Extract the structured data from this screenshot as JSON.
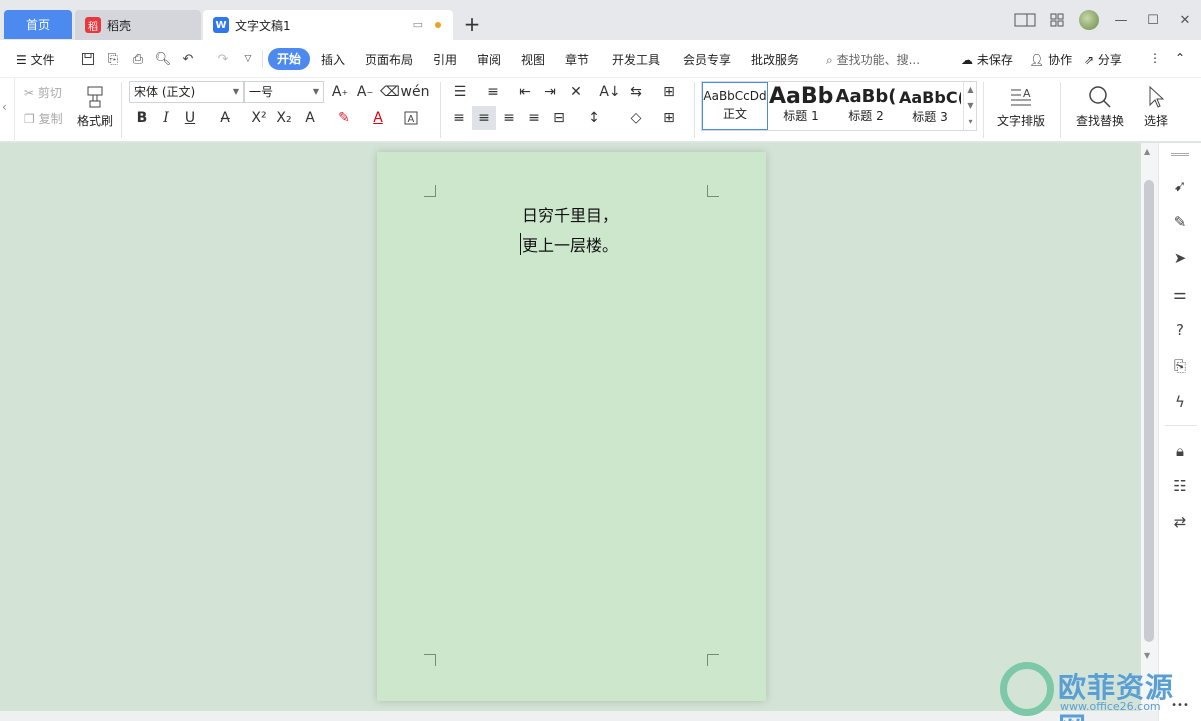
{
  "tabs": {
    "home": "首页",
    "daoke": "稻壳",
    "document": "文字文稿1"
  },
  "menu": {
    "file": "文件",
    "items": [
      "开始",
      "插入",
      "页面布局",
      "引用",
      "审阅",
      "视图",
      "章节",
      "开发工具",
      "会员专享",
      "批改服务"
    ],
    "search_placeholder": "查找功能、搜...",
    "unsaved": "未保存",
    "collaborate": "协作",
    "share": "分享"
  },
  "ribbon": {
    "cut": "剪切",
    "copy": "复制",
    "format_painter": "格式刷",
    "font_name": "宋体 (正文)",
    "font_size": "一号",
    "styles": [
      {
        "preview": "AaBbCcDd",
        "name": "正文"
      },
      {
        "preview": "AaBb",
        "name": "标题 1"
      },
      {
        "preview": "AaBb(",
        "name": "标题 2"
      },
      {
        "preview": "AaBbC(",
        "name": "标题 3"
      }
    ],
    "text_layout": "文字排版",
    "find_replace": "查找替换",
    "select": "选择"
  },
  "document": {
    "lines": [
      "日穷千里目，",
      "更上一层楼。"
    ]
  },
  "watermark": {
    "brand": "欧菲资源网",
    "url": "www.office26.com"
  },
  "colors": {
    "accent": "#4d8af0",
    "page_bg": "#cde7cd",
    "doc_bg": "#d3e4d6"
  }
}
